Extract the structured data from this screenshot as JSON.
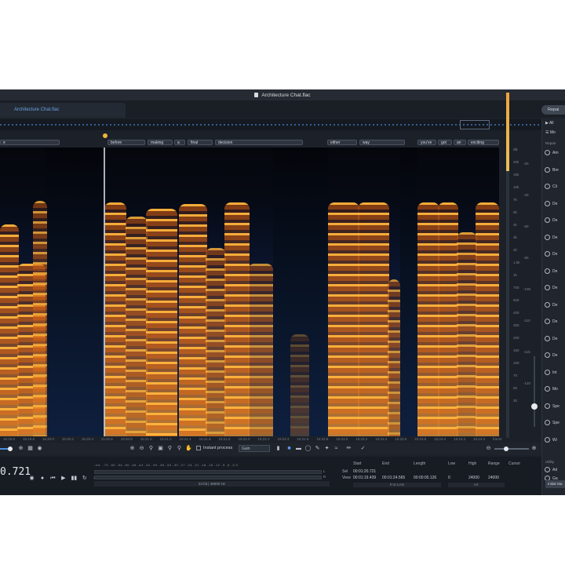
{
  "window": {
    "title": "Architecture Chat.flac"
  },
  "tabs": [
    {
      "label": "Architecture Chat.flac"
    }
  ],
  "toolbar_right": {
    "repair_button": "Repai"
  },
  "words": [
    {
      "text": "e"
    },
    {
      "text": "before"
    },
    {
      "text": "making"
    },
    {
      "text": "a"
    },
    {
      "text": "final"
    },
    {
      "text": "decision"
    },
    {
      "text": "either"
    },
    {
      "text": "way"
    },
    {
      "text": "you've"
    },
    {
      "text": "got"
    },
    {
      "text": "an"
    },
    {
      "text": "exciting"
    }
  ],
  "freq_ticks": [
    "dB",
    "20k",
    "15k",
    "10k",
    "7k",
    "5k",
    "4k",
    "3k",
    "2k",
    "1.5k",
    "1k",
    "700",
    "500",
    "400",
    "300",
    "200",
    "150",
    "100",
    "70",
    "50",
    "30"
  ],
  "db_ticks": [
    "-20",
    "-40",
    "-60",
    "-80",
    "-100",
    "-110",
    "-115",
    "-120"
  ],
  "timeline": [
    "15:19.6",
    "15:19.8",
    "15:20.0",
    "15:20.2",
    "15:20.4",
    "15:20.6",
    "15:20.8",
    "15:21.0",
    "15:21.2",
    "15:21.4",
    "15:21.6",
    "15:21.8",
    "15:22.0",
    "15:22.2",
    "15:22.4",
    "15:22.6",
    "15:22.8",
    "15:23.0",
    "15:23.2",
    "15:23.4",
    "15:23.6",
    "15:23.8",
    "15:24.0",
    "15:24.2",
    "15:24.4",
    "frame"
  ],
  "toolbar": {
    "instant_process_label": "Instant process",
    "mode_value": "Gain"
  },
  "transport": {
    "timecode": "0.721"
  },
  "meter": {
    "scale": "-Inf.  -70  -60  -54 -50 -46 -44 -42 -39 -36 -33 -30 -27 -24 -21 -18 -15 -12  -9  -6  -3  0",
    "left_label": "L",
    "right_label": "R",
    "format": "24 bit | 48000 Hz"
  },
  "selection": {
    "headers": {
      "start": "Start",
      "end": "End",
      "length": "Length",
      "low": "Low",
      "high": "High",
      "range": "Range",
      "cursor": "Cursor"
    },
    "sel_label": "Sel",
    "view_label": "View",
    "sel": {
      "start": "00:01:20.721",
      "end": "",
      "length": "",
      "low": "",
      "high": "",
      "range": ""
    },
    "view": {
      "start": "00:01:19.439",
      "end": "00:01:24.565",
      "length": "00:00:05.126",
      "low": "0",
      "high": "24000",
      "range": "24000"
    },
    "time_unit": "h:m:s.ms",
    "freq_unit": "Hz"
  },
  "panel": {
    "all_label": "All",
    "mod_label": "Mo",
    "section_repair": "Repair",
    "modules": [
      "Am",
      "Bre",
      "Cli",
      "De",
      "De",
      "De",
      "De",
      "De",
      "De",
      "De",
      "De",
      "De",
      "De",
      "Int",
      "Mo",
      "Spe",
      "Spe",
      "Wi"
    ],
    "section_utility": "Utility",
    "utility_modules": [
      "Ad",
      "Ga"
    ],
    "initial_state": "Initial Sta"
  }
}
